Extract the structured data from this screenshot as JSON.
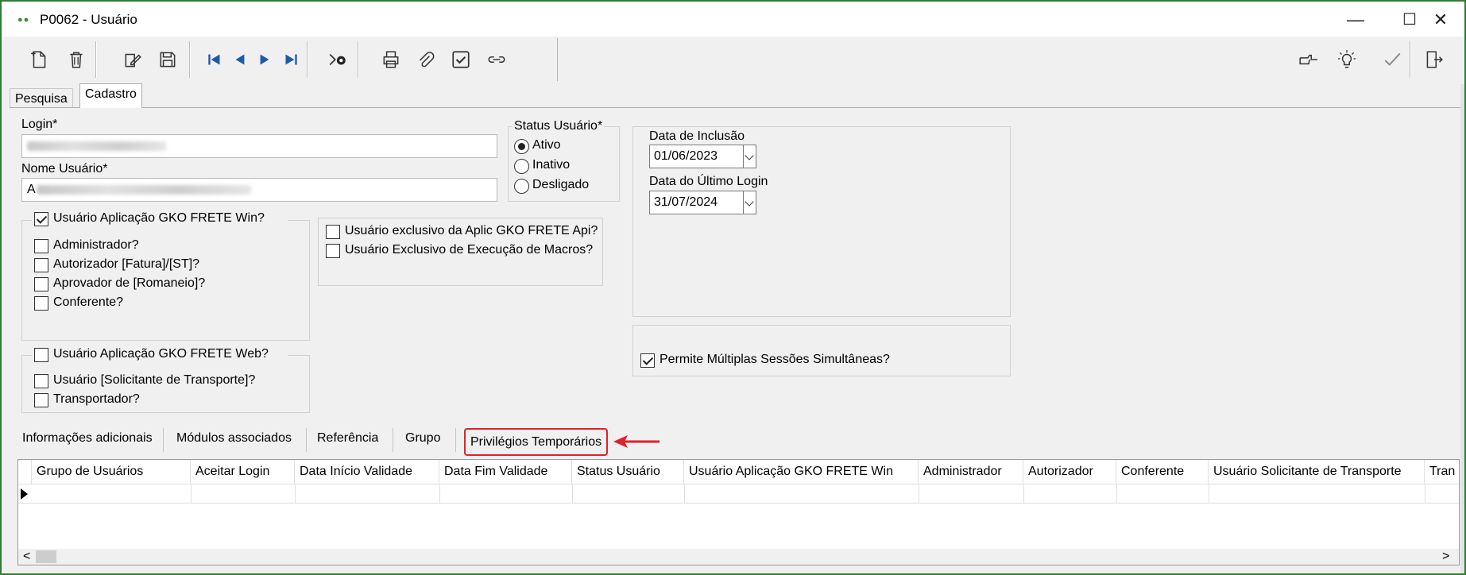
{
  "window": {
    "title": "P0062 - Usuário",
    "dots": "●●",
    "minimize": "—",
    "maximize": "☐",
    "close": "✕"
  },
  "toolbar": {
    "left_icons": [
      "new-document-icon",
      "delete-icon",
      "edit-icon",
      "save-icon",
      "first-record-icon",
      "previous-record-icon",
      "next-record-icon",
      "last-record-icon",
      "search-record-icon",
      "print-icon",
      "attachment-icon",
      "checklist-icon",
      "link-icon"
    ],
    "right_icons": [
      "pointer-hand-icon",
      "lightbulb-icon",
      "confirm-check-icon",
      "exit-door-icon"
    ]
  },
  "tabs": [
    {
      "label": "Pesquisa"
    },
    {
      "label": "Cadastro",
      "active": true
    }
  ],
  "form": {
    "login_label": "Login*",
    "nome_label": "Nome Usuário*",
    "nome_value_prefix": "A",
    "status_label": "Status Usuário*",
    "status_options": [
      {
        "label": "Ativo",
        "selected": true
      },
      {
        "label": "Inativo",
        "selected": false
      },
      {
        "label": "Desligado",
        "selected": false
      }
    ],
    "data_inclusao_label": "Data de Inclusão",
    "data_inclusao": "01/06/2023",
    "data_ultimo_login_label": "Data do Último Login",
    "data_ultimo_login": "31/07/2024",
    "win_group": {
      "label": "Usuário Aplicação GKO FRETE Win?",
      "checked": true,
      "items": [
        {
          "label": "Administrador?",
          "checked": false
        },
        {
          "label": "Autorizador [Fatura]/[ST]?",
          "checked": false
        },
        {
          "label": "Aprovador de [Romaneio]?",
          "checked": false
        },
        {
          "label": "Conferente?",
          "checked": false
        }
      ]
    },
    "api_group": {
      "items": [
        {
          "label": "Usuário exclusivo da Aplic GKO FRETE Api?",
          "checked": false
        },
        {
          "label": "Usuário Exclusivo de Execução de Macros?",
          "checked": false
        }
      ]
    },
    "web_group": {
      "label": "Usuário Aplicação GKO FRETE Web?",
      "checked": false,
      "items": [
        {
          "label": "Usuário [Solicitante de Transporte]?",
          "checked": false
        },
        {
          "label": "Transportador?",
          "checked": false
        }
      ]
    },
    "multi_sessions": {
      "label": "Permite Múltiplas Sessões Simultâneas?",
      "checked": true
    }
  },
  "subtabs": [
    {
      "label": "Informações adicionais"
    },
    {
      "label": "Módulos associados"
    },
    {
      "label": "Referência"
    },
    {
      "label": "Grupo"
    },
    {
      "label": "Privilégios Temporários",
      "highlighted": true
    }
  ],
  "annotation_color": "#e0202a",
  "grid": {
    "columns": [
      "Grupo de Usuários",
      "Aceitar Login",
      "Data Início Validade",
      "Data Fim Validade",
      "Status Usuário",
      "Usuário Aplicação GKO FRETE Win",
      "Administrador",
      "Autorizador",
      "Conferente",
      "Usuário Solicitante de Transporte",
      "Tran"
    ],
    "scroll_left": "<",
    "scroll_right": ">"
  }
}
